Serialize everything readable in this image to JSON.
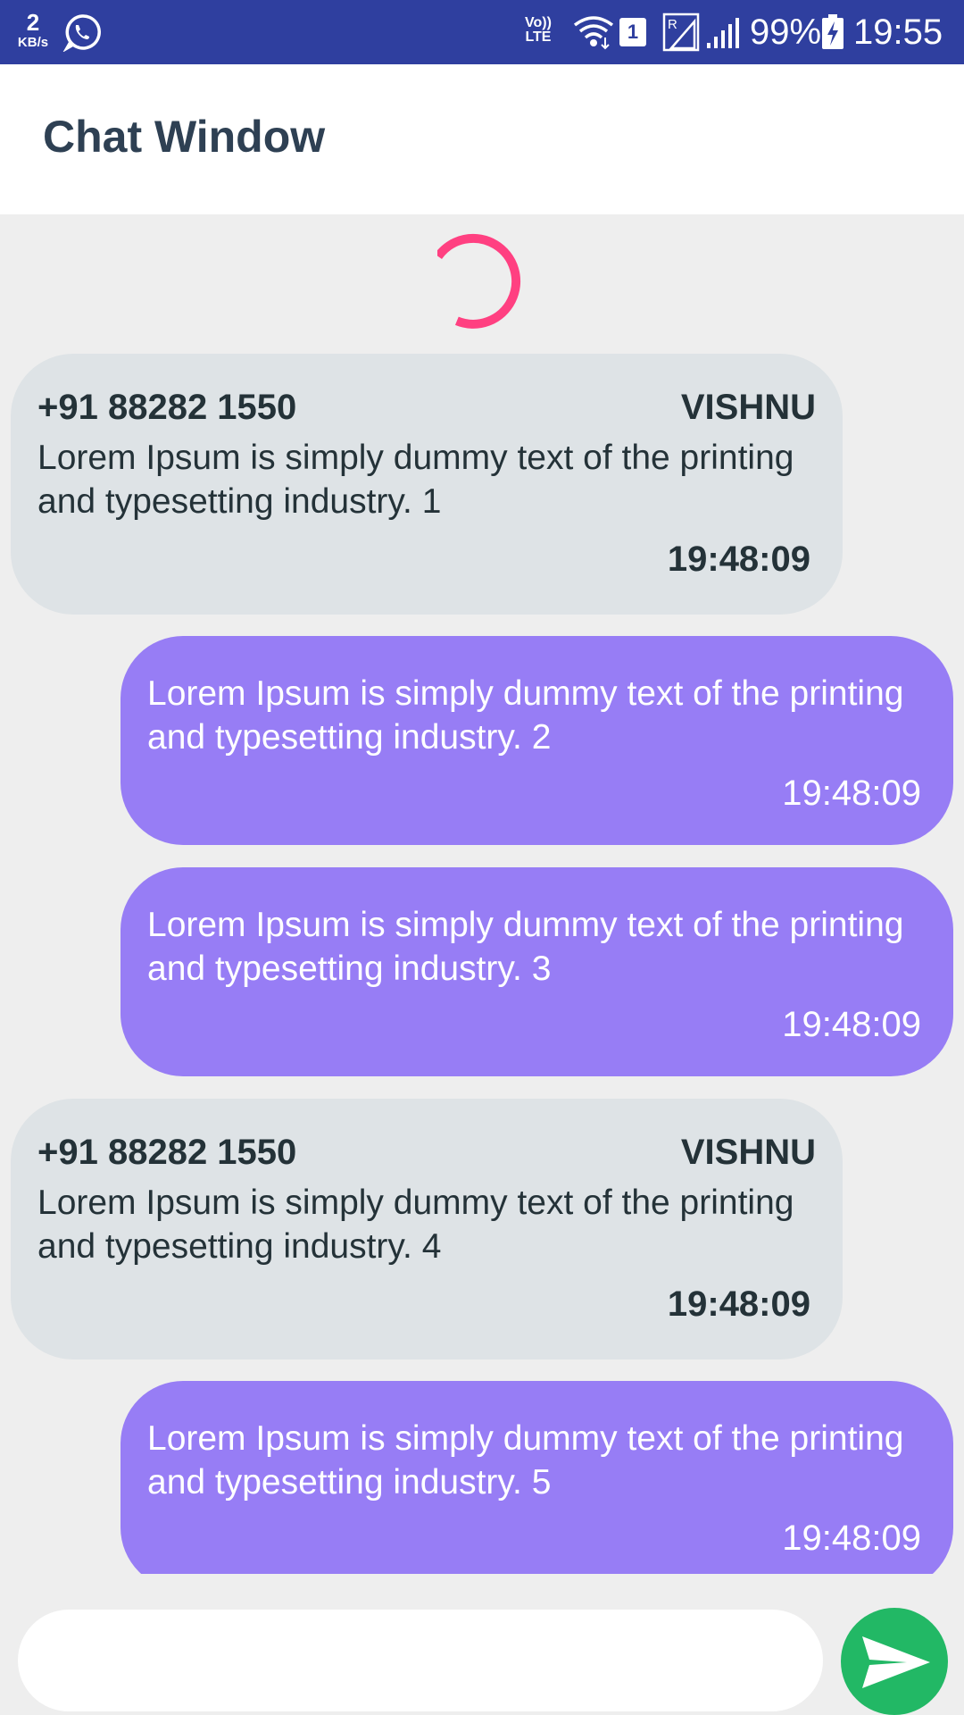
{
  "status_bar": {
    "speed_value": "2",
    "speed_unit": "KB/s",
    "volte_top": "Vo))",
    "volte_bottom": "LTE",
    "sim_slot": "1",
    "battery_percent": "99%",
    "time": "19:55",
    "icons": [
      "whatsapp-icon",
      "wifi-icon",
      "roaming-signal-icon",
      "signal-icon",
      "battery-charging-icon"
    ]
  },
  "app_bar": {
    "title": "Chat Window"
  },
  "loading": {
    "spinner_color": "#ff4081"
  },
  "messages": [
    {
      "direction": "incoming",
      "phone": "+91 88282 1550",
      "name": "VISHNU",
      "text": "Lorem Ipsum is simply dummy text of the printing and typesetting industry. 1",
      "time": "19:48:09"
    },
    {
      "direction": "outgoing",
      "text": "Lorem Ipsum is simply dummy text of the printing and typesetting industry. 2",
      "time": "19:48:09"
    },
    {
      "direction": "outgoing",
      "text": "Lorem Ipsum is simply dummy text of the printing and typesetting industry. 3",
      "time": "19:48:09"
    },
    {
      "direction": "incoming",
      "phone": "+91 88282 1550",
      "name": "VISHNU",
      "text": "Lorem Ipsum is simply dummy text of the printing and typesetting industry. 4",
      "time": "19:48:09"
    },
    {
      "direction": "outgoing",
      "text": "Lorem Ipsum is simply dummy text of the printing and typesetting industry. 5",
      "time": "19:48:09"
    }
  ],
  "composer": {
    "input_value": "",
    "placeholder": "",
    "send_icon": "send-icon"
  },
  "colors": {
    "status_bar": "#2f3f9f",
    "incoming_bubble": "#dee3e6",
    "outgoing_bubble": "#977df5",
    "send_button": "#22b865",
    "background": "#eeeeee",
    "title_text": "#2e4053"
  }
}
